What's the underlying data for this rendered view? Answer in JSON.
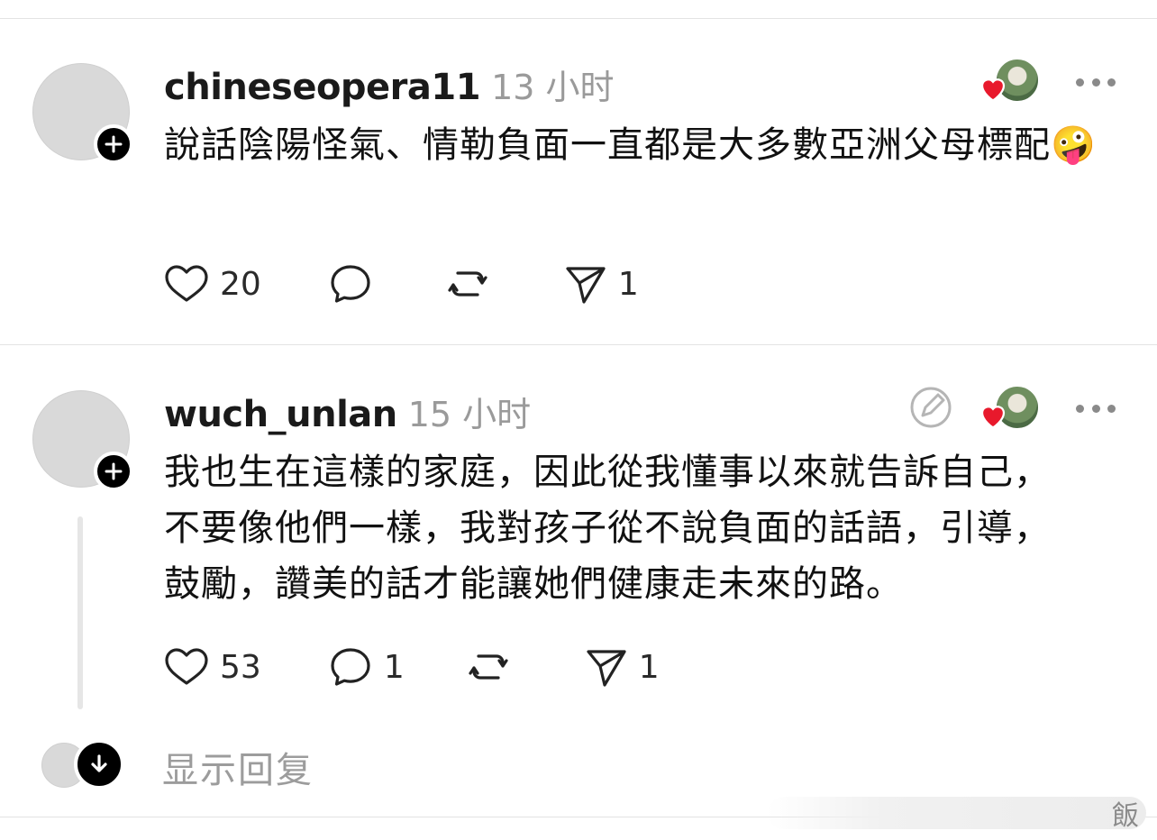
{
  "posts": [
    {
      "username": "chineseopera11",
      "time": "13 小时",
      "text": "說話陰陽怪氣、情勒負面一直都是大多數亞洲父母標配🤪",
      "likes": "20",
      "comments": "",
      "reposts": "",
      "shares": "1"
    },
    {
      "username": "wuch_unlan",
      "time": "15 小时",
      "text": "我也生在這樣的家庭，因此從我懂事以來就告訴自己，不要像他們一樣，我對孩子從不說負面的話語，引導，鼓勵，讚美的話才能讓她們健康走未來的路。",
      "likes": "53",
      "comments": "1",
      "reposts": "",
      "shares": "1"
    }
  ],
  "replies_toggle": {
    "label": "显示回复"
  },
  "watermark": {
    "text": "飯"
  },
  "colors": {
    "heart_red": "#e8192c",
    "secondary_text": "#9a9a9a",
    "icon_gray": "#8a8a8a"
  }
}
